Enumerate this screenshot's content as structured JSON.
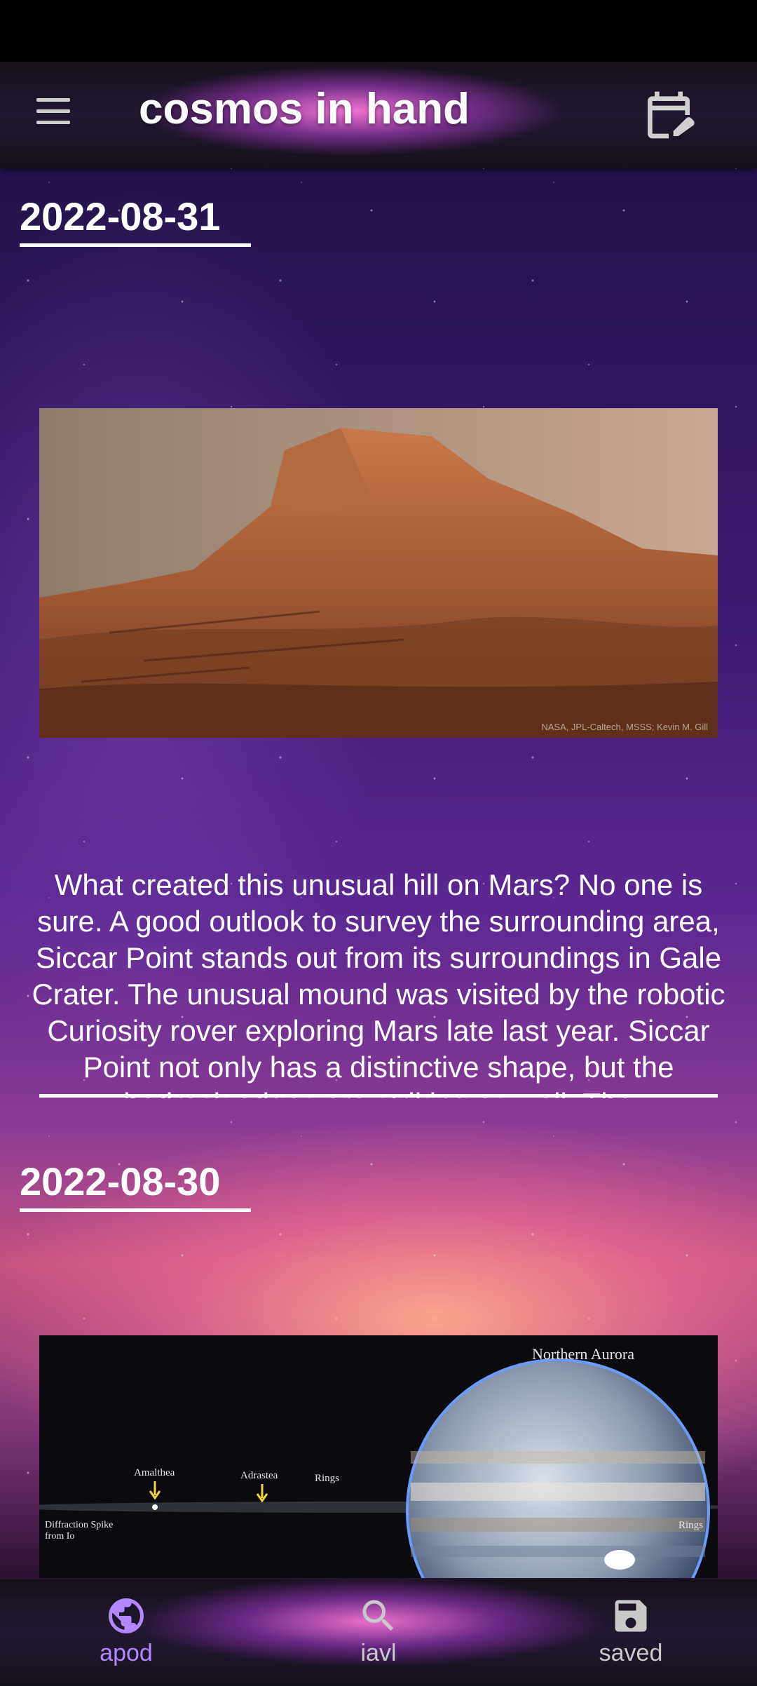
{
  "app": {
    "title": "cosmos in hand"
  },
  "entries": [
    {
      "date": "2022-08-31",
      "explanation": "What created this unusual hill on Mars? No one is sure.  A good outlook to survey the surrounding area, Siccar Point stands out from its surroundings in Gale Crater. The unusual mound was visited by the robotic Curiosity rover exploring Mars late last year. Siccar Point not only has a distinctive shape, but the bedrock edges are striking as well. The",
      "credit": "NASA, JPL-Caltech, MSSS; Kevin M. Gill"
    },
    {
      "date": "2022-08-30",
      "image_labels": {
        "northern_aurora": "Northern Aurora",
        "amalthea": "Amalthea",
        "adrastea": "Adrastea",
        "rings_left": "Rings",
        "rings_right": "Rings",
        "diffraction": "Diffraction Spike",
        "diffraction_sub": "from Io"
      }
    }
  ],
  "nav": {
    "items": [
      {
        "label": "apod",
        "icon": "globe-icon",
        "active": true
      },
      {
        "label": "iavl",
        "icon": "search-icon",
        "active": false
      },
      {
        "label": "saved",
        "icon": "save-icon",
        "active": false
      }
    ],
    "active_color": "#b388ff",
    "inactive_color": "#c9c9c9"
  }
}
